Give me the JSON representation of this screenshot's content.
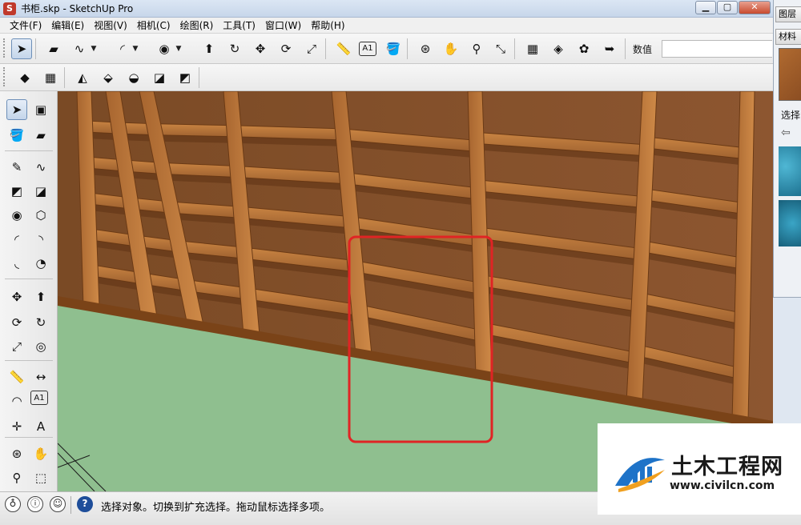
{
  "window": {
    "title": "书柜.skp - SketchUp Pro",
    "app_icon_glyph": "S",
    "controls": {
      "minimize": "▁",
      "maximize": "▢",
      "close": "✕"
    }
  },
  "menu": [
    "文件(F)",
    "编辑(E)",
    "视图(V)",
    "相机(C)",
    "绘图(R)",
    "工具(T)",
    "窗口(W)",
    "帮助(H)"
  ],
  "toolbar": {
    "measurements_label": "数值",
    "primary_icons": [
      {
        "name": "select-tool-icon",
        "glyph": "➤"
      },
      {
        "name": "eraser-tool-icon",
        "glyph": "▰"
      },
      {
        "name": "freehand-tool-icon",
        "glyph": "∿"
      },
      {
        "name": "arc-tool-icon",
        "glyph": "◜"
      },
      {
        "name": "circle-tool-icon",
        "glyph": "◉"
      },
      {
        "name": "push-pull-tool-icon",
        "glyph": "⬆"
      },
      {
        "name": "follow-me-tool-icon",
        "glyph": "↻"
      },
      {
        "name": "move-tool-icon",
        "glyph": "✥"
      },
      {
        "name": "rotate-tool-icon",
        "glyph": "⟳"
      },
      {
        "name": "scale-tool-icon",
        "glyph": "⤢"
      },
      {
        "name": "tape-measure-tool-icon",
        "glyph": "📏"
      },
      {
        "name": "text-tool-icon",
        "glyph": "A1"
      },
      {
        "name": "paint-bucket-tool-icon",
        "glyph": "🪣"
      },
      {
        "name": "orbit-tool-icon",
        "glyph": "⊛"
      },
      {
        "name": "pan-tool-icon",
        "glyph": "✋"
      },
      {
        "name": "zoom-tool-icon",
        "glyph": "⚲"
      },
      {
        "name": "zoom-extents-tool-icon",
        "glyph": "⤡"
      },
      {
        "name": "warehouse-icon",
        "glyph": "▦"
      },
      {
        "name": "share-model-icon",
        "glyph": "◈"
      },
      {
        "name": "extension-warehouse-icon",
        "glyph": "✿"
      },
      {
        "name": "send-to-layout-icon",
        "glyph": "➥"
      }
    ],
    "secondary_icons": [
      {
        "name": "sandbox-from-contours-icon",
        "glyph": "◆"
      },
      {
        "name": "sandbox-from-scratch-icon",
        "glyph": "▦"
      },
      {
        "name": "smoove-icon",
        "glyph": "◭"
      },
      {
        "name": "stamp-icon",
        "glyph": "⬙"
      },
      {
        "name": "drape-icon",
        "glyph": "◒"
      },
      {
        "name": "add-detail-icon",
        "glyph": "◪"
      },
      {
        "name": "flip-edge-icon",
        "glyph": "◩"
      }
    ]
  },
  "left_toolbar": [
    {
      "name": "select-icon",
      "glyph": "➤"
    },
    {
      "name": "make-component-icon",
      "glyph": "▣"
    },
    {
      "name": "paint-bucket-icon",
      "glyph": "🪣"
    },
    {
      "name": "eraser-icon",
      "glyph": "▰"
    },
    {
      "name": "line-icon",
      "glyph": "✎"
    },
    {
      "name": "freehand-icon",
      "glyph": "∿"
    },
    {
      "name": "rectangle-icon",
      "glyph": "◩"
    },
    {
      "name": "rotated-rectangle-icon",
      "glyph": "◪"
    },
    {
      "name": "circle-icon",
      "glyph": "◉"
    },
    {
      "name": "polygon-icon",
      "glyph": "⬡"
    },
    {
      "name": "arc-icon",
      "glyph": "◜"
    },
    {
      "name": "two-point-arc-icon",
      "glyph": "◝"
    },
    {
      "name": "three-point-arc-icon",
      "glyph": "◟"
    },
    {
      "name": "pie-icon",
      "glyph": "◔"
    },
    {
      "name": "move-icon",
      "glyph": "✥"
    },
    {
      "name": "push-pull-icon",
      "glyph": "⬆"
    },
    {
      "name": "rotate-icon",
      "glyph": "⟳"
    },
    {
      "name": "follow-me-icon",
      "glyph": "↻"
    },
    {
      "name": "scale-icon",
      "glyph": "⤢"
    },
    {
      "name": "offset-icon",
      "glyph": "◎"
    },
    {
      "name": "tape-measure-icon",
      "glyph": "📏"
    },
    {
      "name": "dimension-icon",
      "glyph": "↔"
    },
    {
      "name": "protractor-icon",
      "glyph": "◠"
    },
    {
      "name": "text-icon",
      "glyph": "A1"
    },
    {
      "name": "axes-icon",
      "glyph": "✛"
    },
    {
      "name": "3d-text-icon",
      "glyph": "A"
    },
    {
      "name": "orbit-icon",
      "glyph": "⊛"
    },
    {
      "name": "pan-icon",
      "glyph": "✋"
    },
    {
      "name": "zoom-icon",
      "glyph": "⚲"
    },
    {
      "name": "zoom-window-icon",
      "glyph": "⬚"
    }
  ],
  "right_panel": {
    "tabs": [
      "图层",
      "材料"
    ],
    "select_label": "选择",
    "back_glyph": "⇦"
  },
  "status": {
    "text": "选择对象。切换到扩充选择。拖动鼠标选择多项。",
    "icons": [
      {
        "name": "geo-location-icon",
        "glyph": "♁"
      },
      {
        "name": "credits-icon",
        "glyph": "ⓘ"
      },
      {
        "name": "user-account-icon",
        "glyph": "☺"
      },
      {
        "name": "help-icon",
        "glyph": "?"
      }
    ]
  },
  "watermark": {
    "title": "土木工程网",
    "url": "www.civilcn.com"
  },
  "colors": {
    "viewport_ground": "#8fbf8f",
    "wood_light": "#b8763a",
    "wood_dark": "#6b3a15",
    "highlight": "#e02424"
  }
}
